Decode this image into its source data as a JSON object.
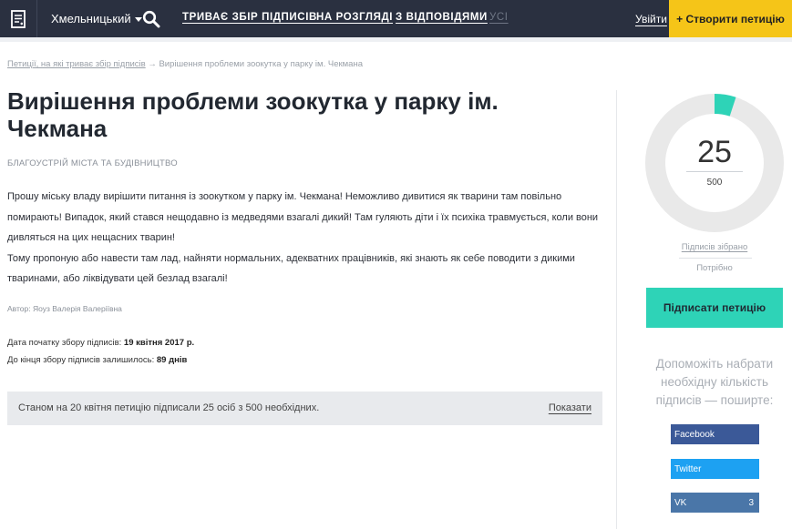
{
  "header": {
    "city": "Хмельницький",
    "nav": [
      {
        "label": "ТРИВАЄ ЗБІР ПІДПИСІВ"
      },
      {
        "label": "НА РОЗГЛЯДІ"
      },
      {
        "label": "З ВІДПОВІДЯМИ"
      },
      {
        "label": "УСІ"
      }
    ],
    "login": "Увійти",
    "create": "+ Створити петицію"
  },
  "breadcrumb": {
    "link": "Петиції, на які триває збір підписів",
    "arrow": "→",
    "current": "Вирішення проблеми зоокутка у парку ім. Чекмана"
  },
  "petition": {
    "title": "Вирішення проблеми зоокутка у парку ім. Чекмана",
    "category": "БЛАГОУСТРІЙ МІСТА ТА БУДІВНИЦТВО",
    "paragraphs": [
      "Прошу міську владу вирішити питання із зоокутком у парку ім. Чекмана! Неможливо дивитися як тварини там повільно помирають! Випадок, який стався нещодавно із медведями взагалі дикий! Там гуляють діти і їх психіка травмується, коли вони дивляться на цих нещасних тварин!",
      "Тому пропоную або навести там лад, найняти нормальних, адекватних працівників, які знають як себе поводити з дикими тваринами, або ліквідувати цей безлад взагалі!"
    ],
    "author": "Автор: Яоуз Валерія Валеріївна",
    "start_label": "Дата початку збору підписів: ",
    "start_date": "19 квітня 2017 р.",
    "remaining_label": "До кінця збору підписів залишилось: ",
    "remaining": "89 днів",
    "status_text": "Станом на 20 квітня петицію підписали 25 осіб з 500 необхідних.",
    "show_label": "Показати"
  },
  "sidebar": {
    "signatures": "25",
    "target": "500",
    "progress_fraction": 0.05,
    "collected_label": "Підписів зібрано",
    "needed_label": "Потрібно",
    "sign_button": "Підписати петицію",
    "help_text": "Допоможіть набрати необхідну кількість підписів — поширте:",
    "share": [
      {
        "label": "Facebook",
        "count": ""
      },
      {
        "label": "Twitter",
        "count": ""
      },
      {
        "label": "VK",
        "count": "3"
      }
    ]
  },
  "colors": {
    "topbar": "#2a3040",
    "accent_yellow": "#f5c518",
    "accent_teal": "#2ed3b7",
    "donut_track": "#e9e9e9"
  },
  "icons": {
    "logo": "document-icon",
    "search": "search-icon"
  }
}
